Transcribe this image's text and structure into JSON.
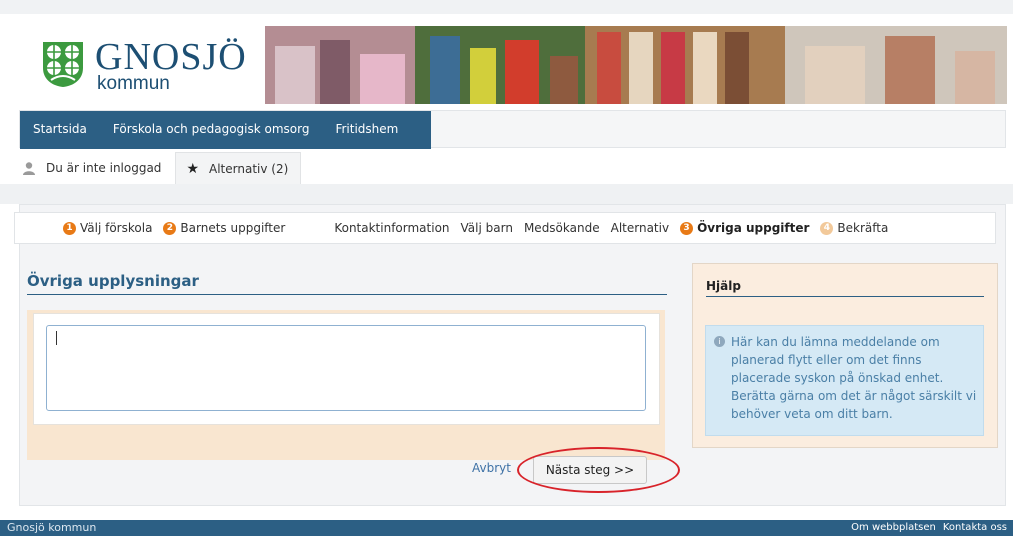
{
  "logo": {
    "name": "GNOSJÖ",
    "sub": "kommun"
  },
  "nav": {
    "items": [
      {
        "label": "Startsida"
      },
      {
        "label": "Förskola och pedagogisk omsorg"
      },
      {
        "label": "Fritidshem"
      }
    ]
  },
  "userbar": {
    "login_status": "Du är inte inloggad",
    "alternatives": "Alternativ (2)"
  },
  "steps": {
    "items": [
      {
        "num": "1",
        "label": "Välj förskola"
      },
      {
        "num": "2",
        "label": "Barnets uppgifter"
      },
      {
        "label": "Kontaktinformation"
      },
      {
        "label": "Välj barn"
      },
      {
        "label": "Medsökande"
      },
      {
        "label": "Alternativ"
      },
      {
        "num": "3",
        "label": "Övriga uppgifter"
      },
      {
        "num": "4",
        "label": "Bekräfta"
      }
    ],
    "active_index": 6
  },
  "main": {
    "title": "Övriga upplysningar",
    "textarea_value": "",
    "cancel_label": "Avbryt",
    "next_label": "Nästa steg >>"
  },
  "help": {
    "title": "Hjälp",
    "text": "Här kan du lämna meddelande om planerad flytt eller om det finns placerade syskon på önskad enhet. Berätta gärna om det är något särskilt vi behöver veta om ditt barn."
  },
  "footer": {
    "left": "Gnosjö kommun",
    "links": [
      "Om webbplatsen",
      "Kontakta oss"
    ]
  },
  "colors": {
    "brand_blue": "#2c5f84",
    "accent_orange": "#e87a16",
    "help_blue": "#d5e9f5",
    "highlight_red": "#d8232a"
  },
  "icons": [
    "municipality-shield-icon",
    "user-icon",
    "star-icon",
    "info-icon"
  ]
}
